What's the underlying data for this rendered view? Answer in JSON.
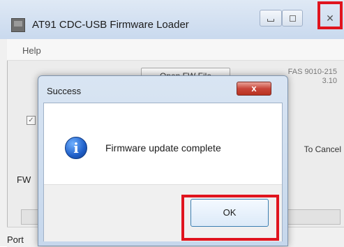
{
  "main_window": {
    "title": "AT91 CDC-USB Firmware Loader",
    "menu": {
      "help": "Help"
    },
    "open_button": "Open FW File",
    "version_text": "FAS 9010-215\n3.10",
    "cancel_hint": "To Cancel",
    "fw_label": "FW",
    "port_label": "Port"
  },
  "dialog": {
    "title": "Success",
    "message": "Firmware update complete",
    "ok_label": "OK",
    "close_glyph": "x"
  },
  "colors": {
    "highlight": "#e0141e",
    "dialog_close": "#c8463a",
    "info_icon": "#1f5fc8"
  },
  "icons": {
    "app": "app-icon",
    "info": "info-icon",
    "close": "close-icon"
  }
}
